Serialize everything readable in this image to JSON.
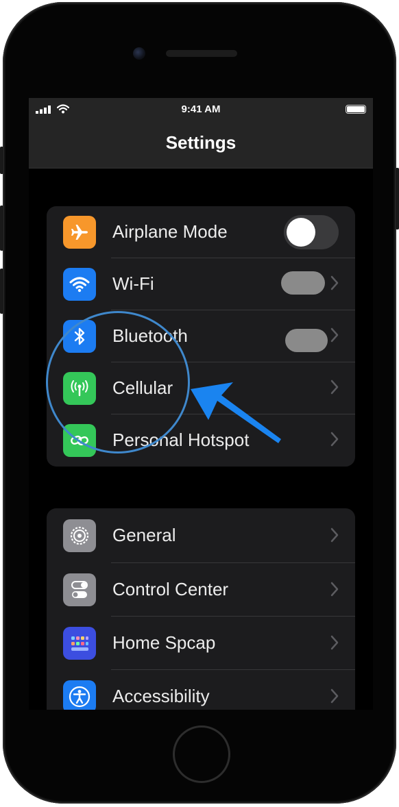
{
  "status_bar": {
    "time": "9:41 AM"
  },
  "nav": {
    "title": "Settings"
  },
  "groups": [
    {
      "rows": [
        {
          "label": "Airplane Mode",
          "icon": "airplane-icon",
          "icon_color": "#f7972b",
          "accessory": "toggle-off"
        },
        {
          "label": "Wi-Fi",
          "icon": "wifi-icon",
          "icon_color": "#1c7cf2",
          "accessory": "value-chevron"
        },
        {
          "label": "Bluetooth",
          "icon": "bluetooth-icon",
          "icon_color": "#1c7cf2",
          "accessory": "value-chevron"
        },
        {
          "label": "Cellular",
          "icon": "antenna-icon",
          "icon_color": "#34c759",
          "accessory": "chevron"
        },
        {
          "label": "Personal Hotspot",
          "icon": "hotspot-link-icon",
          "icon_color": "#34c759",
          "accessory": "chevron"
        }
      ]
    },
    {
      "rows": [
        {
          "label": "General",
          "icon": "gear-icon",
          "icon_color": "#8e8e93",
          "accessory": "chevron"
        },
        {
          "label": "Control Center",
          "icon": "toggles-icon",
          "icon_color": "#8e8e93",
          "accessory": "chevron"
        },
        {
          "label": "Home Spcap",
          "icon": "app-grid-icon",
          "icon_color": "#3c4ee0",
          "accessory": "chevron"
        },
        {
          "label": "Accessibility",
          "icon": "accessibility-icon",
          "icon_color": "#1c7cf2",
          "accessory": "chevron"
        }
      ]
    }
  ],
  "annotations": {
    "circle_color": "#3f88cc",
    "arrow_color": "#1a84f0"
  }
}
